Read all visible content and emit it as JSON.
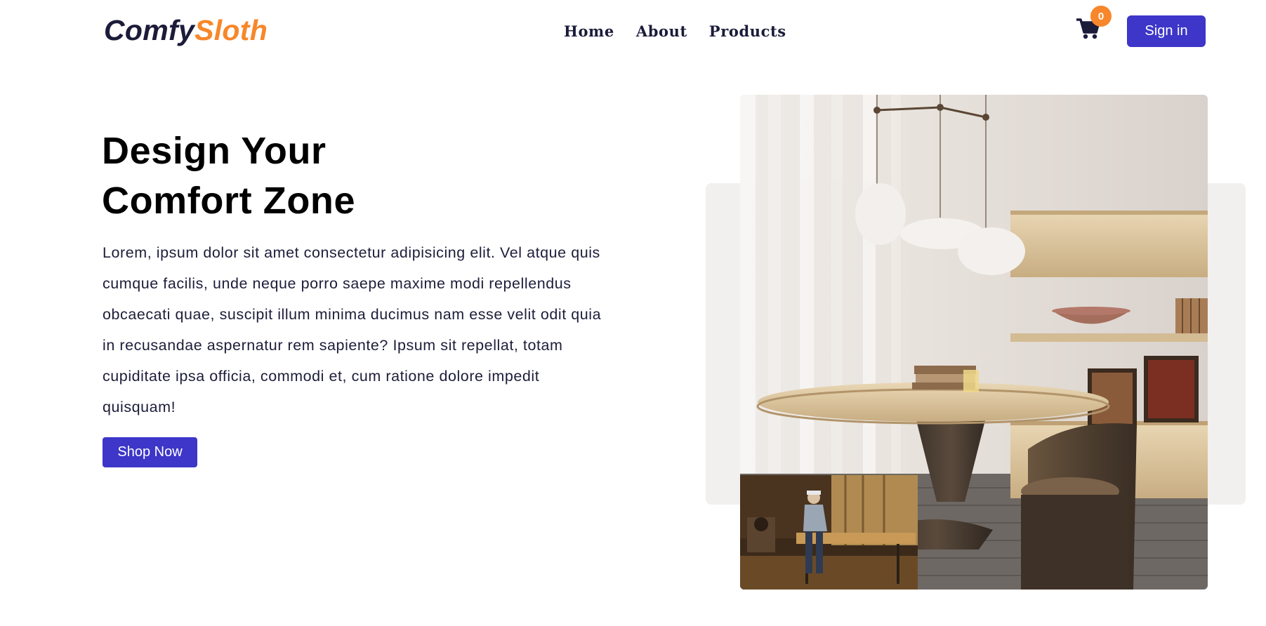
{
  "brand": {
    "part1": "Comfy",
    "part2": "Sloth"
  },
  "nav": {
    "links": [
      "Home",
      "About",
      "Products"
    ]
  },
  "cart": {
    "count": "0",
    "icon": "cart-icon"
  },
  "auth": {
    "signin_label": "Sign in"
  },
  "hero": {
    "title_line1": "Design Your",
    "title_line2": "Comfort Zone",
    "text": "Lorem, ipsum dolor sit amet consectetur adipisicing elit. Vel atque quis cumque facilis, unde neque porro saepe maxime modi repellendus obcaecati quae, suscipit illum minima ducimus nam esse velit odit quia in recusandae aspernatur rem sapiente? Ipsum sit repellat, totam cupiditate ipsa officia, commodi et, cum ratione dolore impedit quisquam!",
    "cta_label": "Shop Now"
  },
  "colors": {
    "primary": "#3d36c8",
    "accent": "#f7872a",
    "dark": "#1b1b3a"
  }
}
